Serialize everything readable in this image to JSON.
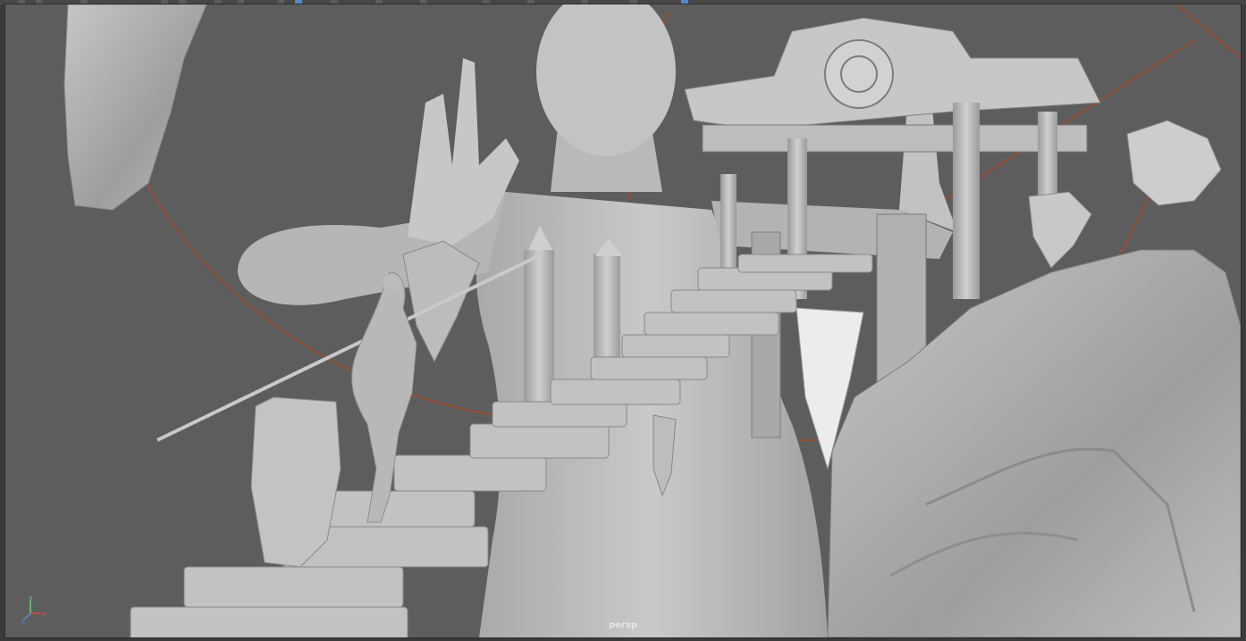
{
  "viewport": {
    "camera_name": "persp",
    "axes": {
      "x": "x",
      "y": "y",
      "z": "z"
    }
  },
  "colors": {
    "background": "#5d5d5d",
    "model_light": "#cfcfcf",
    "model_mid": "#b4b4b4",
    "model_dark": "#8f8f8f",
    "guide_curve": "#b4461f",
    "axis_x": "#e04a4a",
    "axis_y": "#6fd06f",
    "axis_z": "#5a8ae0"
  }
}
